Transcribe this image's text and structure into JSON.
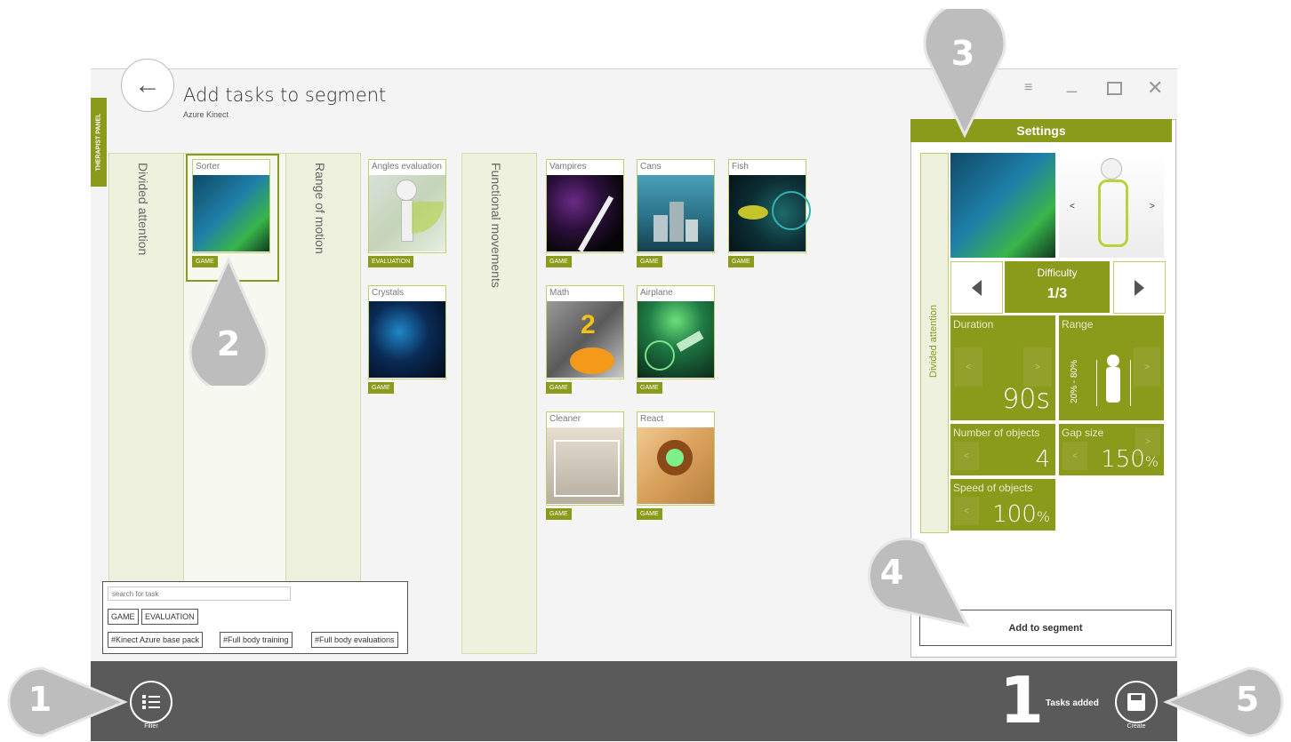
{
  "header": {
    "title": "Add tasks to segment",
    "subtitle": "Azure Kinect",
    "therapist_panel": "THERAPIST PANEL"
  },
  "icons": {
    "back": "arrow-left-icon",
    "settings_sliders": "sliders-icon",
    "minimize": "minimize-icon",
    "maximize": "maximize-icon",
    "close": "close-icon",
    "filter": "list-icon",
    "create": "save-icon"
  },
  "categories": [
    {
      "label": "Divided attention"
    },
    {
      "label": "Range of motion"
    },
    {
      "label": "Functional movements"
    }
  ],
  "tasks": {
    "sorter": {
      "label": "Sorter",
      "tag": "GAME"
    },
    "angles": {
      "label": "Angles evaluation",
      "tag": "EVALUATION"
    },
    "crystals": {
      "label": "Crystals",
      "tag": "GAME"
    },
    "vampires": {
      "label": "Vampires",
      "tag": "GAME"
    },
    "cans": {
      "label": "Cans",
      "tag": "GAME"
    },
    "fish": {
      "label": "Fish",
      "tag": "GAME"
    },
    "math": {
      "label": "Math",
      "tag": "GAME"
    },
    "airplane": {
      "label": "Airplane",
      "tag": "GAME"
    },
    "cleaner": {
      "label": "Cleaner",
      "tag": "GAME"
    },
    "react": {
      "label": "React",
      "tag": "GAME"
    }
  },
  "settings": {
    "title": "Settings",
    "category": "Divided attention",
    "difficulty_label": "Difficulty",
    "difficulty_value": "1/3",
    "duration_label": "Duration",
    "duration_value": "90s",
    "range_label": "Range",
    "range_value": "20% - 80%",
    "objects_label": "Number of objects",
    "objects_value": "4",
    "gap_label": "Gap size",
    "gap_value": "150",
    "gap_unit": "%",
    "speed_label": "Speed of objects",
    "speed_value": "100",
    "speed_unit": "%",
    "add_button": "Add to segment",
    "arrow_left": "<",
    "arrow_right": ">"
  },
  "filter": {
    "search_placeholder": "search for task",
    "tags": [
      "GAME",
      "EVALUATION"
    ],
    "packs": [
      "#Kinect Azure base pack",
      "#Full body training",
      "#Full body evaluations"
    ]
  },
  "bottom": {
    "filter_label": "Filter",
    "tasks_count": "1",
    "tasks_added_label": "Tasks added",
    "create_label": "Create"
  },
  "callouts": [
    "1",
    "2",
    "3",
    "4",
    "5"
  ],
  "colors": {
    "accent": "#8a9a1b",
    "bar": "#5a5a5a"
  }
}
